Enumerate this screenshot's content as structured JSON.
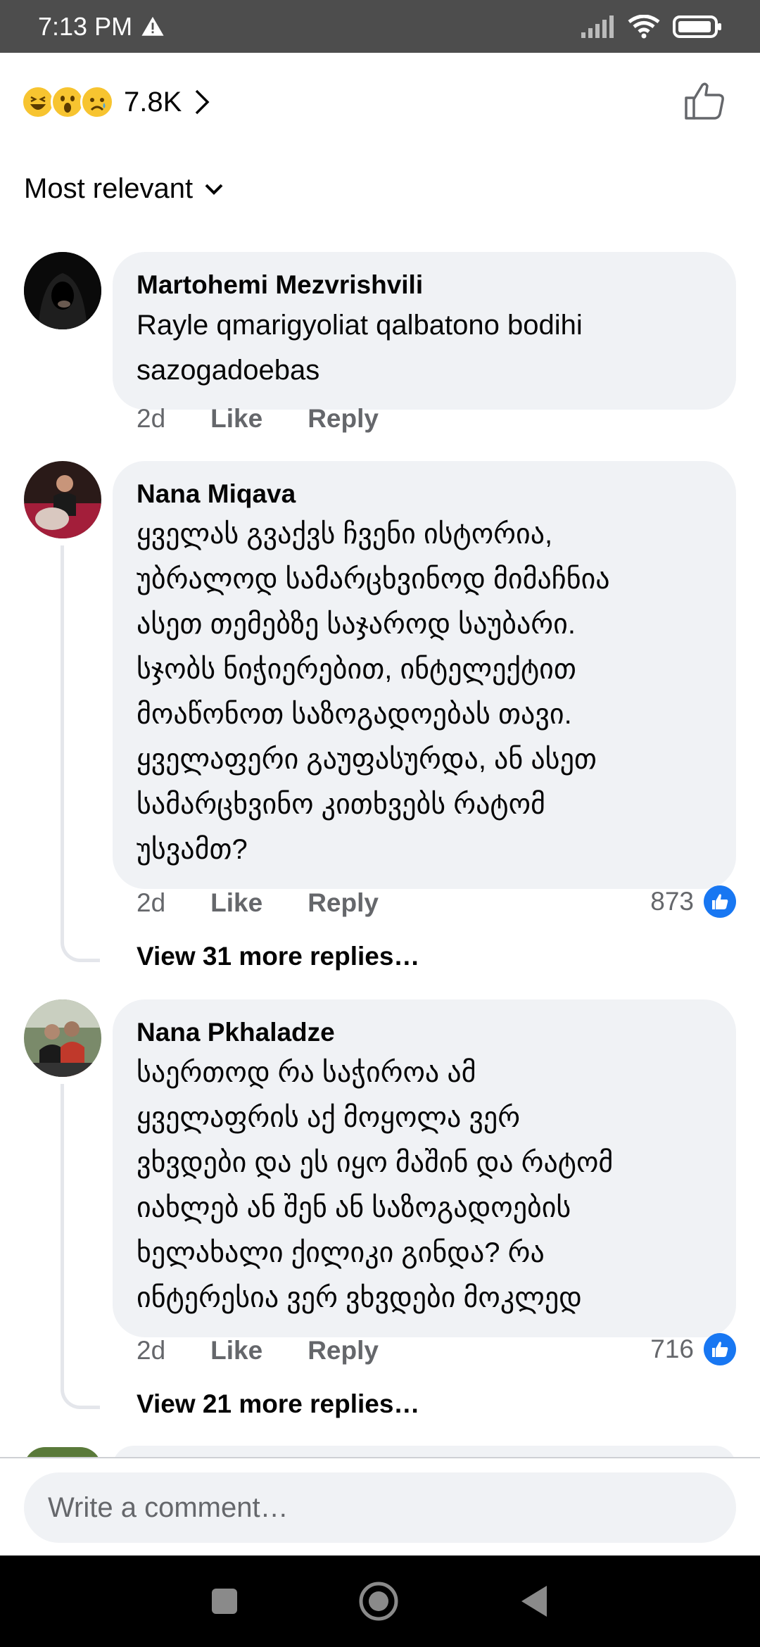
{
  "status_bar": {
    "time": "7:13 PM",
    "battery_icon": "battery-icon",
    "wifi_icon": "wifi-icon",
    "signal_icon": "signal-icon"
  },
  "reactions": {
    "count": "7.8K",
    "emojis": [
      "laughing-emoji",
      "wow-emoji",
      "sad-emoji"
    ]
  },
  "sort": {
    "label": "Most relevant"
  },
  "comments": [
    {
      "author": "Martohemi Mezvrishvili",
      "lines": [
        "Rayle qmarigyoliat qalbatono bodihi",
        "sazogadoebas"
      ],
      "time": "2d",
      "like": "Like",
      "reply": "Reply"
    },
    {
      "author": "Nana Miqava",
      "lines": [
        "ყველას გვაქვს ჩვენი ისტორია,",
        "უბრალოდ სამარცხვინოდ მიმაჩნია",
        "ასეთ თემებზე საჯაროდ საუბარი.",
        "სჯობს ნიჭიერებით, ინტელექტით",
        "მოაწონოთ საზოგადოებას თავი.",
        "ყველაფერი გაუფასურდა, ან ასეთ",
        "სამარცხვინო კითხვებს რატომ",
        "უსვამთ?"
      ],
      "time": "2d",
      "like": "Like",
      "reply": "Reply",
      "likes": "873",
      "view_more": "View 31 more replies…"
    },
    {
      "author": "Nana Pkhaladze",
      "lines": [
        "საერთოდ რა საჭიროა ამ",
        "ყველაფრის აქ მოყოლა ვერ",
        "ვხვდები და ეს იყო მაშინ და რატომ",
        "იახლებ ან შენ ან საზოგადოების",
        "ხელახალი ქილიკი გინდა? რა",
        "ინტერესია ვერ ვხვდები მოკლედ"
      ],
      "time": "2d",
      "like": "Like",
      "reply": "Reply",
      "likes": "716",
      "view_more": "View 21 more replies…"
    }
  ],
  "composer": {
    "placeholder": "Write a comment…"
  },
  "colors": {
    "accent": "#1877f2",
    "bubble": "#f0f2f5",
    "muted": "#65676b"
  }
}
